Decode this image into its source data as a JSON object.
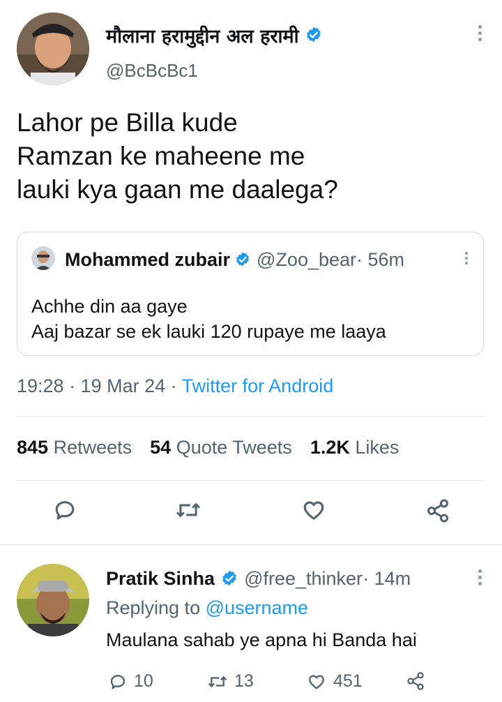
{
  "tweet": {
    "author_name": "मौलाना हरामुद्दीन अल हरामी",
    "author_handle": "@BcBcBc1",
    "text_line1": "Lahor pe Billa kude",
    "text_line2": "Ramzan ke maheene me",
    "text_line3": "lauki kya gaan me daalega?",
    "timestamp": "19:28 · 19 Mar 24 · ",
    "source": "Twitter for Android"
  },
  "quoted": {
    "author_name": "Mohammed zubair",
    "author_handle": "@Zoo_bear",
    "time": " · 56m",
    "text_line1": "Achhe din aa gaye",
    "text_line2": "Aaj bazar se ek lauki 120 rupaye me laaya"
  },
  "stats": {
    "retweets_count": "845",
    "retweets_label": "Retweets",
    "quotes_count": "54",
    "quotes_label": "Quote Tweets",
    "likes_count": "1.2K",
    "likes_label": "Likes"
  },
  "reply": {
    "author_name": "Pratik Sinha",
    "author_handle": "@free_thinker",
    "time": " · 14m",
    "replying_prefix": "Replying to ",
    "replying_to": "@username",
    "text": "Maulana sahab ye apna hi Banda hai",
    "reply_count": "10",
    "retweet_count": "13",
    "like_count": "451"
  },
  "colors": {
    "accent": "#1d9bf0",
    "muted": "#536471",
    "divider": "#e6e9eb"
  },
  "icons": [
    "verified-badge-icon",
    "more-options-icon",
    "reply-icon",
    "retweet-icon",
    "like-icon",
    "share-icon"
  ]
}
